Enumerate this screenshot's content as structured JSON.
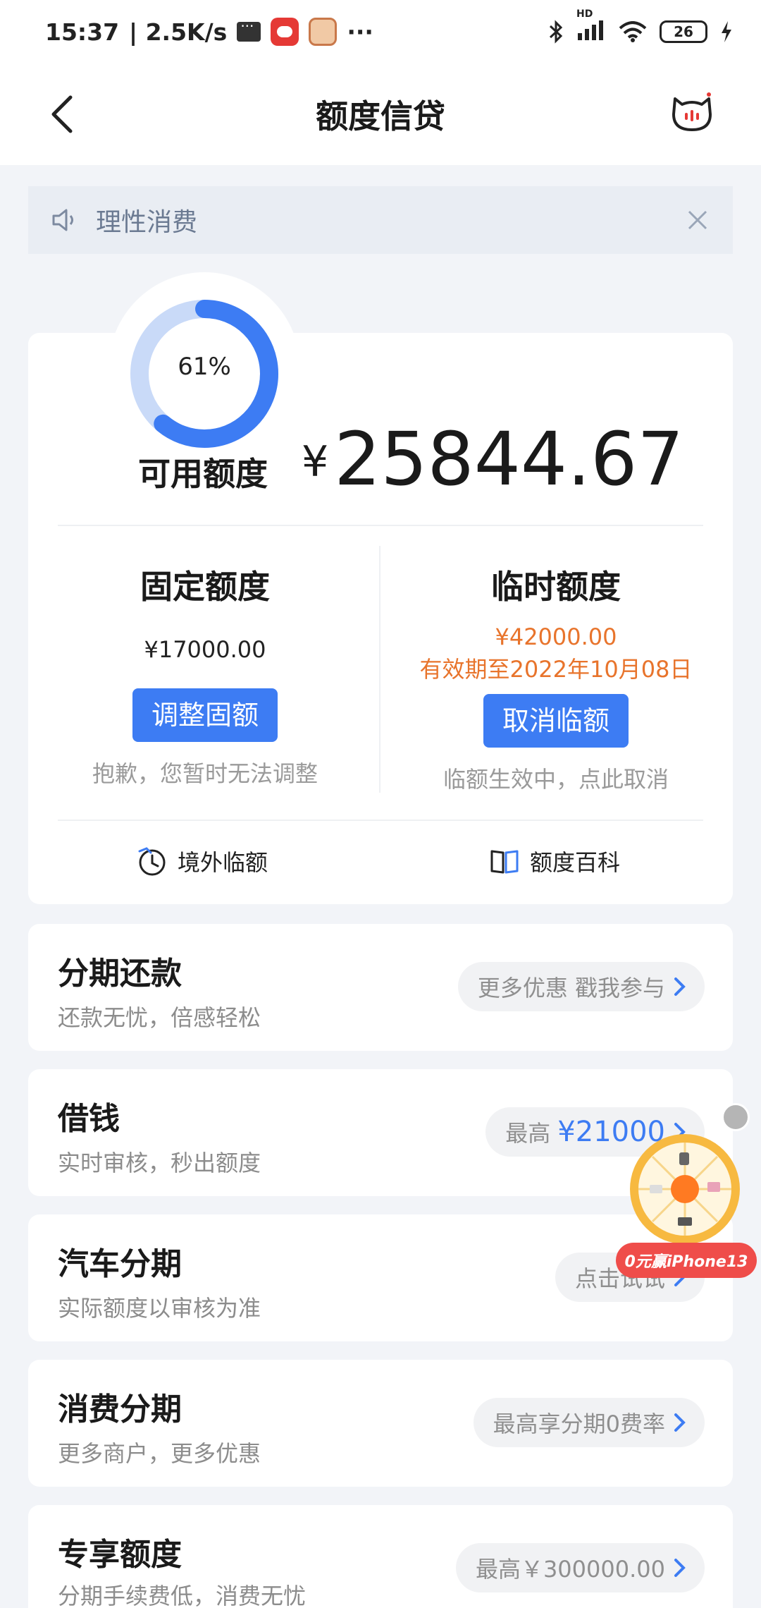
{
  "status_bar": {
    "time": "15:37",
    "speed": "| 2.5K/s",
    "more": "···",
    "hd": "HD",
    "battery": "26"
  },
  "nav": {
    "title": "额度信贷"
  },
  "notice": {
    "text": "理性消费"
  },
  "credit": {
    "progress_percent": 61,
    "progress_label": "61%",
    "available_label": "可用额度",
    "currency": "¥",
    "available_amount": "25844.67",
    "fixed": {
      "title": "固定额度",
      "amount": "¥17000.00",
      "button": "调整固额",
      "hint": "抱歉，您暂时无法调整"
    },
    "temporary": {
      "title": "临时额度",
      "amount": "¥42000.00",
      "validity": "有效期至2022年10月08日",
      "button": "取消临额",
      "hint": "临额生效中，点此取消"
    },
    "links": {
      "overseas": "境外临额",
      "wiki": "额度百科"
    }
  },
  "items": [
    {
      "title": "分期还款",
      "subtitle": "还款无忧，倍感轻松",
      "pill_text": "更多优惠 戳我参与",
      "pill_value": ""
    },
    {
      "title": "借钱",
      "subtitle": "实时审核，秒出额度",
      "pill_text": "最高",
      "pill_value": "¥21000"
    },
    {
      "title": "汽车分期",
      "subtitle": "实际额度以审核为准",
      "pill_text": "点击试试",
      "pill_value": ""
    },
    {
      "title": "消费分期",
      "subtitle": "更多商户，更多优惠",
      "pill_text": "最高享分期0费率",
      "pill_value": ""
    },
    {
      "title": "专享额度",
      "subtitle": "分期手续费低，消费无忧",
      "pill_text": "最高￥300000.00",
      "pill_value": ""
    }
  ],
  "float_promo": {
    "banner": "0元赢iPhone13"
  },
  "colors": {
    "accent": "#3d7cf3",
    "orange": "#e8742c",
    "ring_light": "#c9daf8"
  }
}
